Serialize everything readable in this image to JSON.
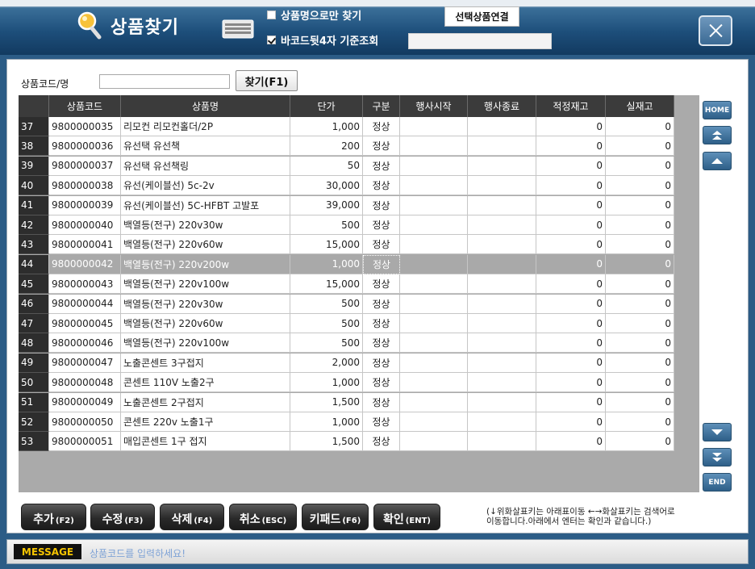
{
  "window": {
    "title": "상품찾기",
    "option_name_only": "상품명으로만 찾기",
    "option_name_only_checked": false,
    "option_barcode4": "바코드뒷4자 기준조회",
    "option_barcode4_checked": true,
    "link_button": "선택상품연결",
    "barcode_value": ""
  },
  "search": {
    "label": "상품코드/명",
    "value": "",
    "find_button": "찾기(F1)"
  },
  "grid": {
    "columns": [
      "",
      "상품코드",
      "상품명",
      "단가",
      "구분",
      "행사시작",
      "행사종료",
      "적정재고",
      "실재고"
    ],
    "selected_row": 7,
    "rows": [
      {
        "idx": "37",
        "code": "9800000035",
        "name": "리모컨 리모컨홀더/2P",
        "price": "1,000",
        "type": "정상",
        "start": "",
        "end": "",
        "optimal": "0",
        "actual": "0"
      },
      {
        "idx": "38",
        "code": "9800000036",
        "name": "유선택 유선책",
        "price": "200",
        "type": "정상",
        "start": "",
        "end": "",
        "optimal": "0",
        "actual": "0"
      },
      {
        "idx": "39",
        "code": "9800000037",
        "name": "유선택 유선책링",
        "price": "50",
        "type": "정상",
        "start": "",
        "end": "",
        "optimal": "0",
        "actual": "0"
      },
      {
        "idx": "40",
        "code": "9800000038",
        "name": "유선(케이블선) 5c-2v",
        "price": "30,000",
        "type": "정상",
        "start": "",
        "end": "",
        "optimal": "0",
        "actual": "0"
      },
      {
        "idx": "41",
        "code": "9800000039",
        "name": "유선(케이블선) 5C-HFBT 고발포",
        "price": "39,000",
        "type": "정상",
        "start": "",
        "end": "",
        "optimal": "0",
        "actual": "0"
      },
      {
        "idx": "42",
        "code": "9800000040",
        "name": "백열등(전구) 220v30w",
        "price": "500",
        "type": "정상",
        "start": "",
        "end": "",
        "optimal": "0",
        "actual": "0"
      },
      {
        "idx": "43",
        "code": "9800000041",
        "name": "백열등(전구) 220v60w",
        "price": "15,000",
        "type": "정상",
        "start": "",
        "end": "",
        "optimal": "0",
        "actual": "0"
      },
      {
        "idx": "44",
        "code": "9800000042",
        "name": "백열등(전구) 220v200w",
        "price": "1,000",
        "type": "정상",
        "start": "",
        "end": "",
        "optimal": "0",
        "actual": "0"
      },
      {
        "idx": "45",
        "code": "9800000043",
        "name": "백열등(전구) 220v100w",
        "price": "15,000",
        "type": "정상",
        "start": "",
        "end": "",
        "optimal": "0",
        "actual": "0"
      },
      {
        "idx": "46",
        "code": "9800000044",
        "name": "백열등(전구) 220v30w",
        "price": "500",
        "type": "정상",
        "start": "",
        "end": "",
        "optimal": "0",
        "actual": "0"
      },
      {
        "idx": "47",
        "code": "9800000045",
        "name": "백열등(전구) 220v60w",
        "price": "500",
        "type": "정상",
        "start": "",
        "end": "",
        "optimal": "0",
        "actual": "0"
      },
      {
        "idx": "48",
        "code": "9800000046",
        "name": "백열등(전구) 220v100w",
        "price": "500",
        "type": "정상",
        "start": "",
        "end": "",
        "optimal": "0",
        "actual": "0"
      },
      {
        "idx": "49",
        "code": "9800000047",
        "name": "노출콘센트 3구접지",
        "price": "2,000",
        "type": "정상",
        "start": "",
        "end": "",
        "optimal": "0",
        "actual": "0"
      },
      {
        "idx": "50",
        "code": "9800000048",
        "name": "콘센트 110V 노출2구",
        "price": "1,000",
        "type": "정상",
        "start": "",
        "end": "",
        "optimal": "0",
        "actual": "0"
      },
      {
        "idx": "51",
        "code": "9800000049",
        "name": "노출콘센트 2구접지",
        "price": "1,500",
        "type": "정상",
        "start": "",
        "end": "",
        "optimal": "0",
        "actual": "0"
      },
      {
        "idx": "52",
        "code": "9800000050",
        "name": "콘센트 220v 노출1구",
        "price": "1,000",
        "type": "정상",
        "start": "",
        "end": "",
        "optimal": "0",
        "actual": "0"
      },
      {
        "idx": "53",
        "code": "9800000051",
        "name": "매입콘센트 1구 접지",
        "price": "1,500",
        "type": "정상",
        "start": "",
        "end": "",
        "optimal": "0",
        "actual": "0"
      }
    ]
  },
  "nav": {
    "home": "HOME",
    "end": "END",
    "icons": [
      "double-up-icon",
      "up-icon",
      "down-icon",
      "double-down-icon"
    ]
  },
  "actions": [
    {
      "label": "추가",
      "key": "(F2)"
    },
    {
      "label": "수정",
      "key": "(F3)"
    },
    {
      "label": "삭제",
      "key": "(F4)"
    },
    {
      "label": "취소",
      "key": "(ESC)"
    },
    {
      "label": "키패드",
      "key": "(F6)"
    },
    {
      "label": "확인",
      "key": "(ENT)"
    }
  ],
  "hint": {
    "line1": "(↓위화살표키는 아래표이동  ←→화살표키는 검색어로",
    "line2": "이동합니다.아래에서 엔터는 확인과 같습니다.)"
  },
  "message": {
    "tag": "MESSAGE",
    "text": "상품코드를 입력하세요!"
  },
  "colors": {
    "title_bar": "#1d4e7a",
    "frame": "#2c5c86",
    "grid_header": "#3b3b3b",
    "selected_row": "#a9a9a9",
    "message_tag_text": "#f5c400",
    "message_text": "#7fa3d6"
  }
}
